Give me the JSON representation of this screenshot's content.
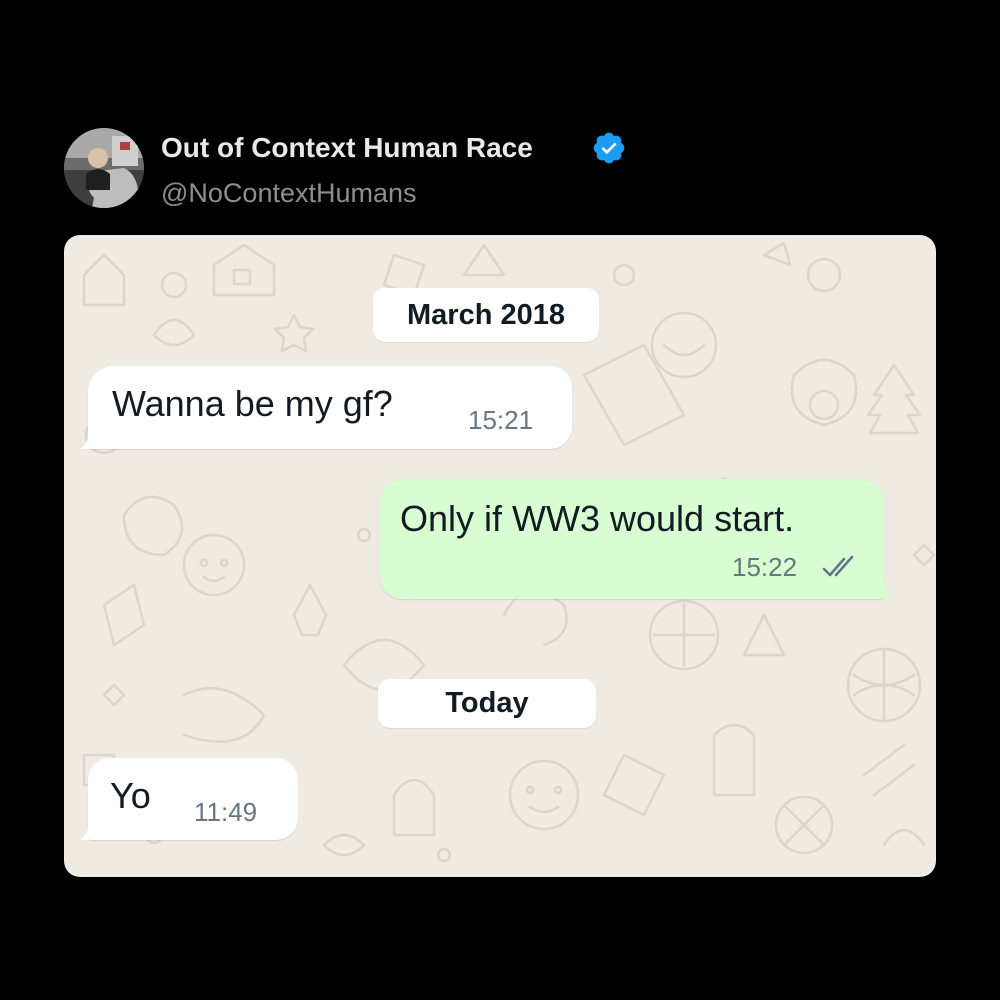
{
  "tweet": {
    "display_name": "Out of Context Human Race",
    "handle": "@NoContextHumans",
    "verified_icon": "verified-badge-icon",
    "verified_color": "#1d9bf0"
  },
  "chat": {
    "background_color": "#efeae2",
    "incoming_bubble_color": "#ffffff",
    "outgoing_bubble_color": "#d9fdd3",
    "date_separators": [
      "March 2018",
      "Today"
    ],
    "messages": [
      {
        "direction": "incoming",
        "text": "Wanna be my gf?",
        "time": "15:21"
      },
      {
        "direction": "outgoing",
        "text": "Only if WW3 would start.",
        "time": "15:22",
        "status_icon": "double-check-icon"
      },
      {
        "direction": "incoming",
        "text": "Yo",
        "time": "11:49"
      }
    ]
  }
}
